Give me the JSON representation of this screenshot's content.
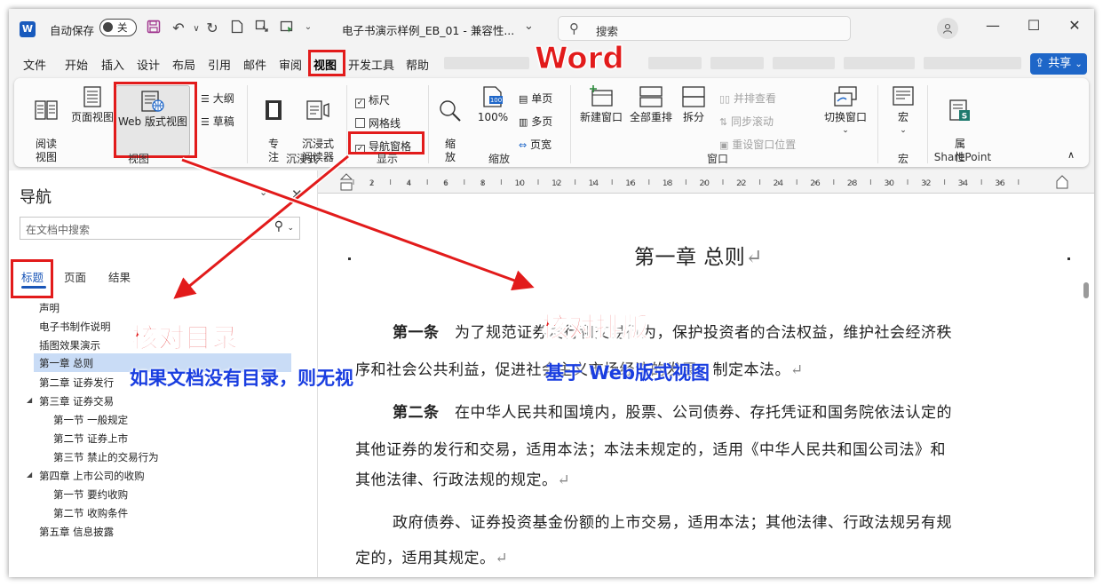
{
  "titlebar": {
    "app_logo": "W",
    "autosave_label": "自动保存",
    "autosave_state": "关",
    "doc_title": "电子书演示样例_EB_01 - 兼容性...",
    "search_placeholder": "搜索",
    "qat_icons": [
      "save-icon",
      "undo-icon",
      "redo-icon",
      "new-doc-icon",
      "touch-mode-icon",
      "read-mode-icon",
      "more-icon"
    ]
  },
  "menu": {
    "tabs": [
      "文件",
      "开始",
      "插入",
      "设计",
      "布局",
      "引用",
      "邮件",
      "审阅",
      "视图",
      "开发工具",
      "帮助"
    ],
    "active_tab": "视图",
    "share_label": "共享"
  },
  "ribbon": {
    "views": {
      "read_mode": "阅读\n视图",
      "print_layout": "页面视图",
      "web_layout": "Web 版式视图",
      "outline": "大纲",
      "draft": "草稿",
      "group_label": "视图"
    },
    "immersive": {
      "focus": "专\n注",
      "immersive_reader": "沉浸式\n阅读器",
      "group_label": "沉浸式"
    },
    "show": {
      "ruler": "标尺",
      "gridlines": "网格线",
      "nav_pane": "导航窗格",
      "ruler_checked": "✓",
      "nav_checked": "✓",
      "group_label": "显示"
    },
    "zoom": {
      "zoom": "缩\n放",
      "zoom100": "100%",
      "one_page": "单页",
      "multi_page": "多页",
      "page_width": "页宽",
      "group_label": "缩放"
    },
    "window": {
      "new_window": "新建窗口",
      "arrange_all": "全部重排",
      "split": "拆分",
      "side_by_side": "并排查看",
      "sync_scroll": "同步滚动",
      "reset_pos": "重设窗口位置",
      "switch_window": "切换窗口",
      "group_label": "窗口"
    },
    "macros": {
      "macro": "宏",
      "group_label": "宏"
    },
    "sharepoint": {
      "properties": "属\n性",
      "group_label": "SharePoint"
    }
  },
  "nav": {
    "title": "导航",
    "search_placeholder": "在文档中搜索",
    "tabs": [
      "标题",
      "页面",
      "结果"
    ],
    "items": [
      "声明",
      "电子书制作说明",
      "插图效果演示",
      "第一章  总则",
      "第二章  证券发行",
      "第三章  证券交易",
      "第一节  一般规定",
      "第二节  证券上市",
      "第三节  禁止的交易行为",
      "第四章  上市公司的收购",
      "第一节  要约收购",
      "第二节  收购条件",
      "第五章  信息披露"
    ]
  },
  "ruler": {
    "labels": [
      "2",
      "4",
      "6",
      "8",
      "10",
      "12",
      "14",
      "16",
      "18",
      "20",
      "22",
      "24",
      "26",
      "28",
      "30",
      "32",
      "34",
      "36"
    ]
  },
  "document": {
    "heading": "第一章    总则",
    "para_mark": "↵",
    "p1_label": "第一条",
    "p1_line1": "为了规范证券发行和交易行为，保护投资者的合法权益，维护社会经济秩",
    "p1_line2": "序和社会公共利益，促进社会主义市场经济的发展，制定本法。",
    "p2_label": "第二条",
    "p2_line1": "在中华人民共和国境内，股票、公司债券、存托凭证和国务院依法认定的",
    "p2_line2": "其他证券的发行和交易，适用本法；本法未规定的，适用《中华人民共和国公司法》和",
    "p2_line3": "其他法律、行政法规的规定。",
    "p3_line1": "政府债券、证券投资基金份额的上市交易，适用本法；其他法律、行政法规另有规",
    "p3_line2": "定的，适用其规定。"
  },
  "annotations": {
    "word": "Word",
    "check_toc": "核对目录",
    "check_layout": "核对排版",
    "no_toc_note": "如果文档没有目录，则无视",
    "web_note": "基于 Web版式视图",
    "colors": {
      "red": "#e21b1b",
      "blue": "#1a3ee0"
    }
  },
  "colors": {
    "accent": "#1e66c8",
    "word_blue": "#185abd"
  }
}
